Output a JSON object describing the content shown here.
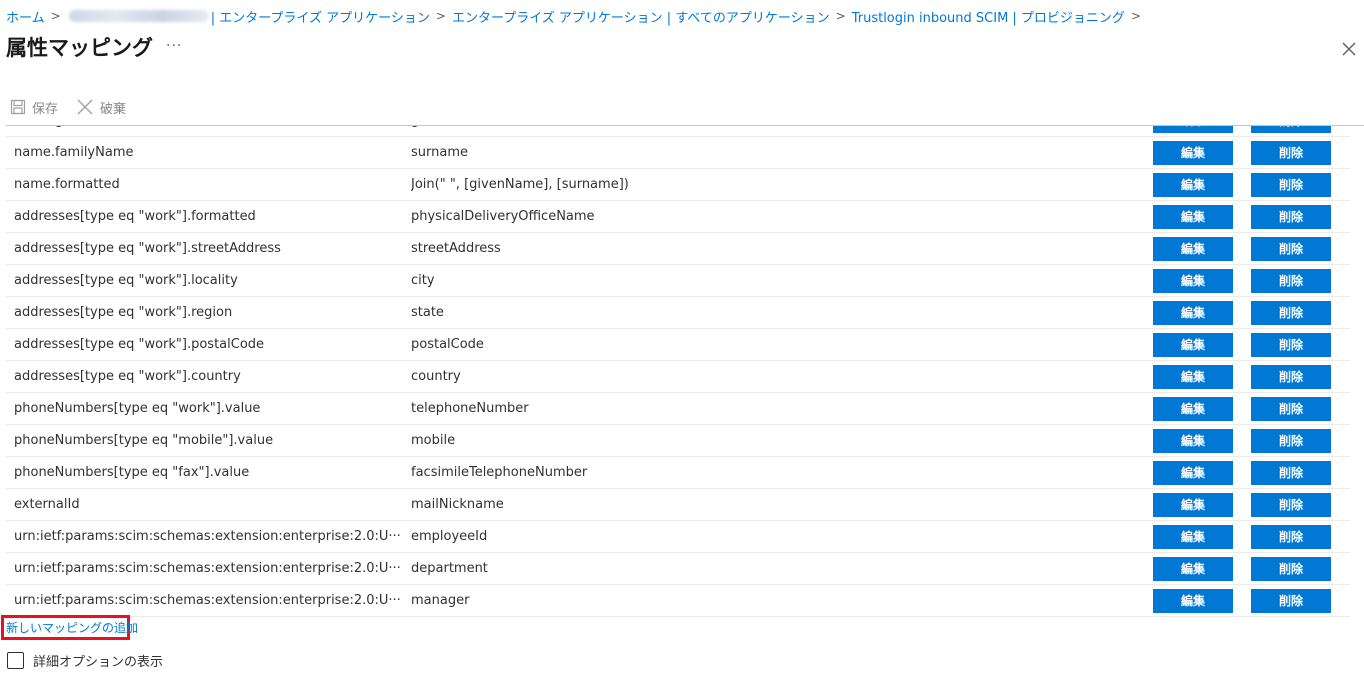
{
  "breadcrumb": {
    "home": "ホーム",
    "item1_suffix": "| エンタープライズ アプリケーション",
    "item2": "エンタープライズ アプリケーション | すべてのアプリケーション",
    "item3": "Trustlogin inbound SCIM | プロビジョニング",
    "separator": ">"
  },
  "page": {
    "title": "属性マッピング",
    "more": "···"
  },
  "toolbar": {
    "save_label": "保存",
    "discard_label": "破棄"
  },
  "mappings": [
    {
      "target": "name.givenName",
      "source": "givenName"
    },
    {
      "target": "name.familyName",
      "source": "surname"
    },
    {
      "target": "name.formatted",
      "source": "Join(\" \", [givenName], [surname])"
    },
    {
      "target": "addresses[type eq \"work\"].formatted",
      "source": "physicalDeliveryOfficeName"
    },
    {
      "target": "addresses[type eq \"work\"].streetAddress",
      "source": "streetAddress"
    },
    {
      "target": "addresses[type eq \"work\"].locality",
      "source": "city"
    },
    {
      "target": "addresses[type eq \"work\"].region",
      "source": "state"
    },
    {
      "target": "addresses[type eq \"work\"].postalCode",
      "source": "postalCode"
    },
    {
      "target": "addresses[type eq \"work\"].country",
      "source": "country"
    },
    {
      "target": "phoneNumbers[type eq \"work\"].value",
      "source": "telephoneNumber"
    },
    {
      "target": "phoneNumbers[type eq \"mobile\"].value",
      "source": "mobile"
    },
    {
      "target": "phoneNumbers[type eq \"fax\"].value",
      "source": "facsimileTelephoneNumber"
    },
    {
      "target": "externalId",
      "source": "mailNickname"
    },
    {
      "target": "urn:ietf:params:scim:schemas:extension:enterprise:2.0:U···",
      "source": "employeeId"
    },
    {
      "target": "urn:ietf:params:scim:schemas:extension:enterprise:2.0:U···",
      "source": "department"
    },
    {
      "target": "urn:ietf:params:scim:schemas:extension:enterprise:2.0:U···",
      "source": "manager"
    }
  ],
  "row_actions": {
    "edit_label": "編集",
    "delete_label": "削除"
  },
  "footer": {
    "add_mapping_label": "新しいマッピングの追加",
    "advanced_options_label": "詳細オプションの表示",
    "advanced_options_checked": false
  },
  "colors": {
    "accent": "#0078d4",
    "highlight_border": "#e81123"
  }
}
